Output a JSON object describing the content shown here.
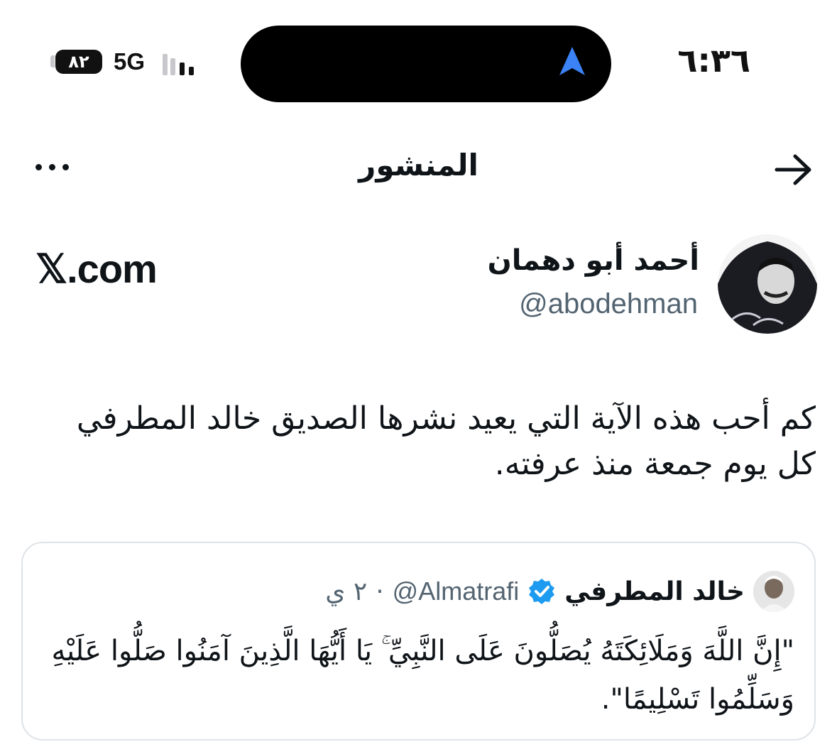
{
  "status_bar": {
    "time": "٦:٣٦",
    "network": "5G",
    "battery": "٨٢"
  },
  "header": {
    "title": "المنشور"
  },
  "post": {
    "author_name": "أحمد أبو دهمان",
    "author_handle": "@abodehman",
    "site_logo": "𝕏.com",
    "text": "كم أحب هذه الآية التي يعيد نشرها الصديق خالد المطرفي كل يوم جمعة منذ عرفته."
  },
  "quoted_post": {
    "author_name": "خالد المطرفي",
    "author_handle": "@Almatrafi",
    "separator": "·",
    "time": "٢ ي",
    "text": "\"إِنَّ اللَّهَ وَمَلَائِكَتَهُ يُصَلُّونَ عَلَى النَّبِيِّ ۚ يَا أَيُّهَا الَّذِينَ آمَنُوا صَلُّوا عَلَيْهِ وَسَلِّمُوا تَسْلِيمًا\"."
  },
  "colors": {
    "verified": "#1d9bf0",
    "secondary_text": "#536471",
    "nav_arrow": "#3b82f6"
  }
}
